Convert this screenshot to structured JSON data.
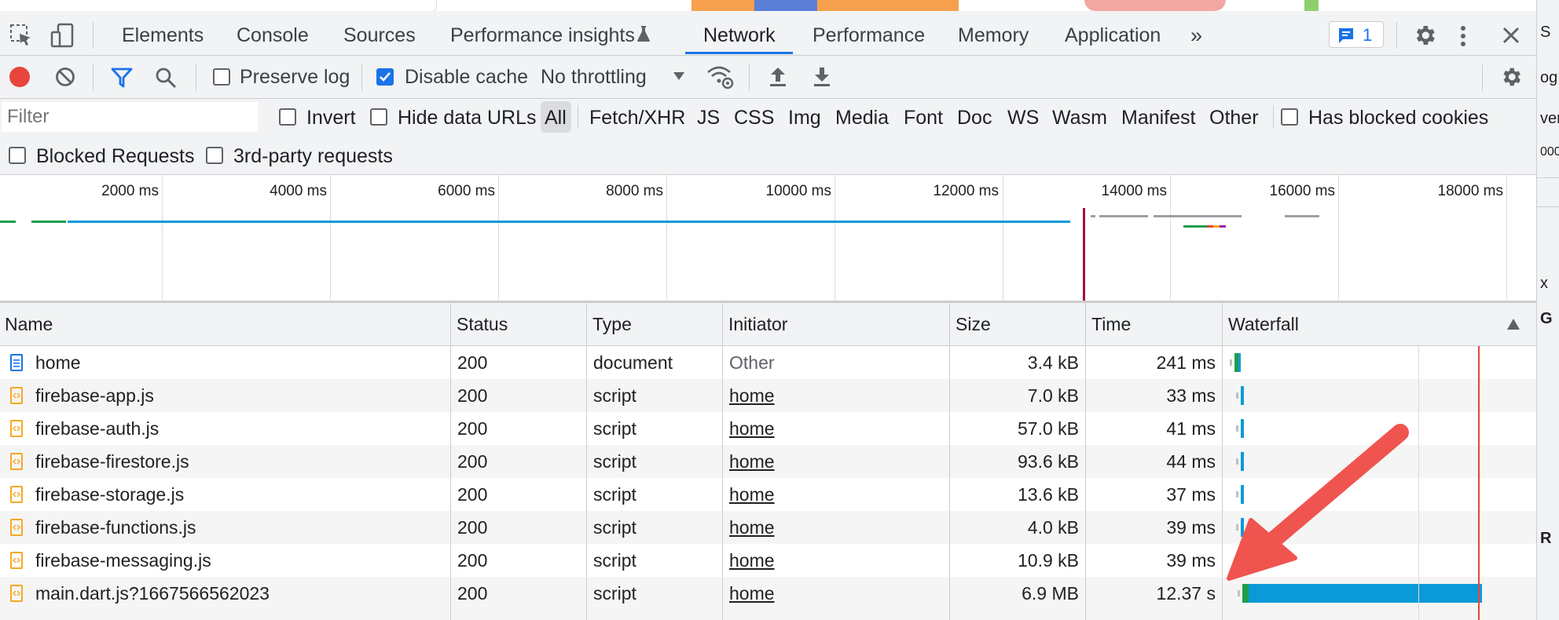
{
  "tabs": {
    "items": [
      "Elements",
      "Console",
      "Sources",
      "Performance insights",
      "Network",
      "Performance",
      "Memory",
      "Application"
    ],
    "active": "Network",
    "more": "»",
    "issues_count": "1"
  },
  "toolbar": {
    "preserve_log": "Preserve log",
    "preserve_log_checked": false,
    "disable_cache": "Disable cache",
    "disable_cache_checked": true,
    "throttling": "No throttling"
  },
  "filters": {
    "placeholder": "Filter",
    "invert": "Invert",
    "hide_data_urls": "Hide data URLs",
    "types": [
      "All",
      "Fetch/XHR",
      "JS",
      "CSS",
      "Img",
      "Media",
      "Font",
      "Doc",
      "WS",
      "Wasm",
      "Manifest",
      "Other"
    ],
    "selected_type": "All",
    "has_blocked_cookies": "Has blocked cookies",
    "blocked_requests": "Blocked Requests",
    "third_party": "3rd-party requests"
  },
  "overview": {
    "ticks": [
      "2000 ms",
      "4000 ms",
      "6000 ms",
      "8000 ms",
      "10000 ms",
      "12000 ms",
      "14000 ms",
      "16000 ms",
      "18000 ms"
    ]
  },
  "table": {
    "headers": [
      "Name",
      "Status",
      "Type",
      "Initiator",
      "Size",
      "Time",
      "Waterfall"
    ],
    "rows": [
      {
        "name": "home",
        "status": "200",
        "type": "document",
        "initiator": "Other",
        "size": "3.4 kB",
        "time": "241 ms",
        "icon": "document-icon"
      },
      {
        "name": "firebase-app.js",
        "status": "200",
        "type": "script",
        "initiator": "home",
        "size": "7.0 kB",
        "time": "33 ms",
        "icon": "script-icon"
      },
      {
        "name": "firebase-auth.js",
        "status": "200",
        "type": "script",
        "initiator": "home",
        "size": "57.0 kB",
        "time": "41 ms",
        "icon": "script-icon"
      },
      {
        "name": "firebase-firestore.js",
        "status": "200",
        "type": "script",
        "initiator": "home",
        "size": "93.6 kB",
        "time": "44 ms",
        "icon": "script-icon"
      },
      {
        "name": "firebase-storage.js",
        "status": "200",
        "type": "script",
        "initiator": "home",
        "size": "13.6 kB",
        "time": "37 ms",
        "icon": "script-icon"
      },
      {
        "name": "firebase-functions.js",
        "status": "200",
        "type": "script",
        "initiator": "home",
        "size": "4.0 kB",
        "time": "39 ms",
        "icon": "script-icon"
      },
      {
        "name": "firebase-messaging.js",
        "status": "200",
        "type": "script",
        "initiator": "home",
        "size": "10.9 kB",
        "time": "39 ms",
        "icon": "script-icon"
      },
      {
        "name": "main.dart.js?1667566562023",
        "status": "200",
        "type": "script",
        "initiator": "home",
        "size": "6.9 MB",
        "time": "12.37 s",
        "icon": "script-icon"
      }
    ]
  },
  "right_panel": {
    "fragments": [
      "S",
      "og",
      "ver",
      "000",
      "x",
      "G",
      "R"
    ]
  },
  "colors": {
    "accent": "#1a73e8",
    "record": "#e8453c",
    "annotation_arrow": "#f0544f",
    "waterfall_blue": "#0b9ad8",
    "waterfall_green": "#1e9e4b"
  }
}
